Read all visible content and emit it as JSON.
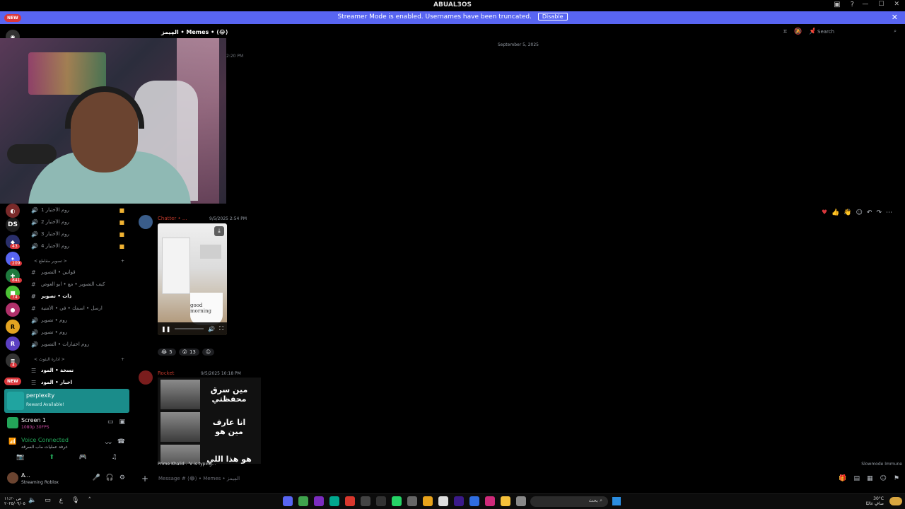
{
  "window": {
    "title": "ABUAL3OS"
  },
  "banner": {
    "message": "Streamer Mode is enabled. Usernames have been truncated.",
    "disable_label": "Disable",
    "new_label": "NEW"
  },
  "header": {
    "channel": "المِيمز • Memes • ⟨😂⟩",
    "search_placeholder": "Search"
  },
  "rail": {
    "badges": [
      "43",
      "209",
      "841",
      "74",
      "4"
    ],
    "labels": [
      "DS",
      "R"
    ]
  },
  "webcam": {
    "caption": ""
  },
  "channels": {
    "voice": [
      "روم الأختبار 1",
      "روم الأختبار 2",
      "روم الأختبار 3",
      "روم الأختبار 4"
    ],
    "category1": "< تصوير مقاطع >",
    "text": [
      {
        "label": "قوانين • التصوير",
        "active": false
      },
      {
        "label": "كيف التصوير • مع • ابو العوص",
        "active": false
      },
      {
        "label": "ذات • تصوير",
        "active": true
      },
      {
        "label": "ارسل • اسمك • في • الأمنية",
        "active": false
      }
    ],
    "voice2": [
      "روم • تصوير",
      "روم • تصوير",
      "روم اختبارات • التصوير"
    ],
    "category2": "< ادارة البثوث >",
    "mode": [
      "نسخة • المود",
      "اخبار • المود"
    ]
  },
  "chat": {
    "date_divider": "September 5, 2025",
    "first_time": "2:20 PM",
    "msg1": {
      "user": "Chatter • ...",
      "time": "9/5/2025 2:54 PM",
      "mug_text": "good morning"
    },
    "reactions": [
      {
        "emoji": "😂",
        "count": "5"
      },
      {
        "emoji": "😮",
        "count": "13"
      },
      {
        "emoji": "☺",
        "count": ""
      }
    ],
    "msg2": {
      "user": "Rocket",
      "time": "9/5/2025 10:18 PM"
    },
    "meme_rows": [
      "مين سرق\nمحفظتي",
      "انا عارف\nمين هو",
      "هو هذا اللي"
    ],
    "typing": "Prime Khalid . 'V is typing...",
    "slowmode": "Slowmode Immune"
  },
  "composer": {
    "placeholder": "Message # ⟨😂⟩ • Memes • المِيمز"
  },
  "perplexity": {
    "title": "perplexity",
    "subtitle": "Reward Available!"
  },
  "screen": {
    "title": "Screen 1",
    "subtitle": "1080p 30FPS"
  },
  "voice": {
    "title": "Voice Connected",
    "subtitle": "غرفة عمليات ماب السرقة"
  },
  "user": {
    "name": "A...",
    "status": "Streaming Roblox"
  },
  "taskbar": {
    "left_line1": "ص ١١:٢٠",
    "left_line2": "٢٠٢٥/٠٩/٠٥",
    "search": "بحث",
    "temp": "30°C",
    "weather_desc": "صافٍ غالبًا"
  }
}
